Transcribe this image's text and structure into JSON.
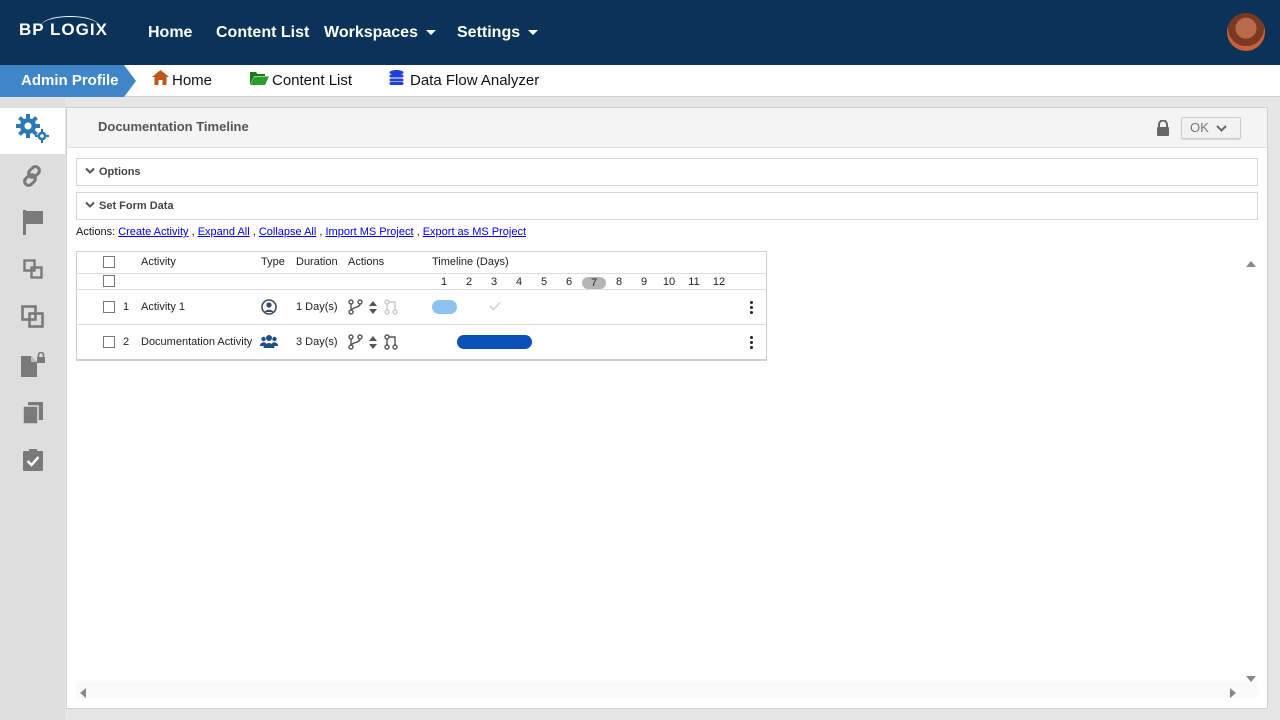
{
  "brand": {
    "logo_text": "BP LOGIX"
  },
  "topnav": {
    "items": [
      {
        "label": "Home"
      },
      {
        "label": "Content List"
      },
      {
        "label": "Workspaces"
      },
      {
        "label": "Settings"
      }
    ]
  },
  "breadcrumb": {
    "profile": "Admin Profile",
    "items": [
      {
        "label": "Home",
        "icon": "house-icon",
        "color": "#c0571a"
      },
      {
        "label": "Content List",
        "icon": "folder-open-icon",
        "color": "#1c8a1c"
      },
      {
        "label": "Data Flow Analyzer",
        "icon": "database-icon",
        "color": "#1f3fd6"
      }
    ]
  },
  "sidebar": {
    "items": [
      "gears-icon",
      "link-icon",
      "flag-icon",
      "copy-icon",
      "duplicate-icon",
      "document-lock-icon",
      "documents-icon",
      "checklist-icon"
    ]
  },
  "panel": {
    "title": "Documentation Timeline",
    "ok_label": "OK",
    "sections": [
      {
        "label": "Options"
      },
      {
        "label": "Set Form Data"
      }
    ],
    "actions": {
      "prefix": "Actions:",
      "links": [
        "Create Activity",
        "Expand All",
        "Collapse All",
        "Import MS Project",
        "Export as MS Project"
      ]
    }
  },
  "grid": {
    "headers": {
      "activity": "Activity",
      "type": "Type",
      "duration": "Duration",
      "actions": "Actions",
      "timeline": "Timeline (Days)"
    },
    "days": [
      "1",
      "2",
      "3",
      "4",
      "5",
      "6",
      "7",
      "8",
      "9",
      "10",
      "11",
      "12"
    ],
    "highlighted_day": "7",
    "rows": [
      {
        "num": "1",
        "name": "Activity 1",
        "type_icon": "user-circle-icon",
        "duration": "1 Day(s)",
        "bar_start_day": 1,
        "bar_days": 1,
        "bar_color": "#8cc4ef",
        "completed": true
      },
      {
        "num": "2",
        "name": "Documentation Activity",
        "type_icon": "users-group-icon",
        "duration": "3 Day(s)",
        "bar_start_day": 2,
        "bar_days": 3,
        "bar_color": "#0b4fb8",
        "completed": false
      }
    ]
  },
  "colors": {
    "nav_bg": "#0b3357",
    "accent": "#3e86c7"
  }
}
